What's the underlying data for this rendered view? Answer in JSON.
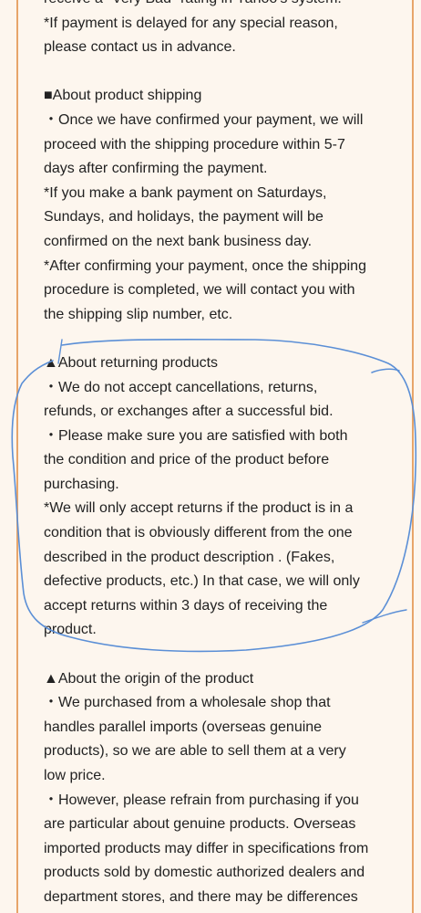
{
  "blocks": [
    {
      "lines": [
        "receive a \"Very Bad\" rating in Yahoo's system.",
        "*If payment is delayed for any special reason,",
        "please contact us in advance."
      ]
    },
    {
      "lines": [
        "■About product shipping",
        "・Once we have confirmed your payment, we will",
        "proceed with the shipping procedure within 5-7",
        "days after confirming the payment.",
        "*If you make a bank payment on Saturdays,",
        "Sundays, and holidays, the payment will be",
        "confirmed on the next bank business day.",
        "*After confirming your payment, once the shipping",
        "procedure is completed, we will contact you with",
        "the shipping slip number, etc."
      ]
    },
    {
      "lines": [
        "▲About returning products",
        "・We do not accept cancellations, returns,",
        "refunds, or exchanges after a successful bid.",
        "・Please make sure you are satisfied with both",
        "the condition and price of the product before",
        "purchasing.",
        "*We will only accept returns if the product is in a",
        "condition that is obviously different from the one",
        "described in the product description . (Fakes,",
        "defective products, etc.) In that case, we will only",
        "accept returns within 3 days of receiving the",
        "product."
      ]
    },
    {
      "lines": [
        "▲About the origin of the product",
        "・We purchased from a wholesale shop that",
        "handles parallel imports (overseas genuine",
        "products), so we are able to sell them at a very",
        "low price.",
        "・However, please refrain from purchasing if you",
        "are particular about genuine products. Overseas",
        "imported products may differ in specifications from",
        "products sold by domestic authorized dealers and",
        "department stores, and there may be differences"
      ]
    }
  ],
  "colors": {
    "background": "#fdf6ee",
    "border": "#e7a56a",
    "text": "#222222",
    "annotation": "#5b8fd6"
  }
}
